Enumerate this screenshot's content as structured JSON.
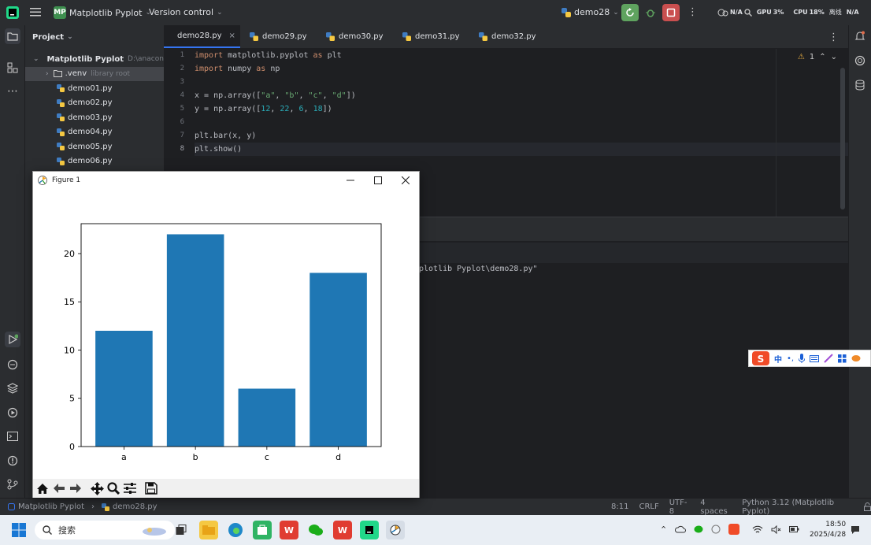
{
  "titlebar": {
    "project_badge": "MP",
    "project_name": "Matplotlib Pyplot",
    "vcs": "Version control",
    "run_config": "demo28",
    "hw_na_1": "N/A",
    "gpu_label": "GPU",
    "gpu_value": "3%",
    "cpu_label": "CPU",
    "cpu_value": "18%",
    "cpu_extra": "离线",
    "hw_na_2": "N/A"
  },
  "project_panel": {
    "header": "Project",
    "root": {
      "name": "Matplotlib Pyplot",
      "path": "D:\\anacond"
    },
    "venv": {
      "name": ".venv",
      "note": "library root"
    },
    "files": [
      "demo01.py",
      "demo02.py",
      "demo03.py",
      "demo04.py",
      "demo05.py",
      "demo06.py"
    ]
  },
  "tabs": [
    "demo28.py",
    "demo29.py",
    "demo30.py",
    "demo31.py",
    "demo32.py"
  ],
  "editor": {
    "warnings": "1",
    "line_numbers": [
      "1",
      "2",
      "3",
      "4",
      "5",
      "6",
      "7",
      "8"
    ],
    "code": {
      "l1": {
        "kw1": "import",
        "mod": " matplotlib.pyplot ",
        "kw2": "as",
        "alias": " plt"
      },
      "l2": {
        "kw1": "import",
        "mod": " numpy ",
        "kw2": "as",
        "alias": " np"
      },
      "l4": {
        "a": "x = np.array([",
        "s1": "\"a\"",
        "c1": ", ",
        "s2": "\"b\"",
        "c2": ", ",
        "s3": "\"c\"",
        "c3": ", ",
        "s4": "\"d\"",
        "b": "])"
      },
      "l5": {
        "a": "y = np.array([",
        "n1": "12",
        "c1": ", ",
        "n2": "22",
        "c2": ", ",
        "n3": "6",
        "c3": ", ",
        "n4": "18",
        "b": "])"
      },
      "l7": "plt.bar(x, y)",
      "l8": "plt.show()"
    }
  },
  "run_output": "plotlib Pyplot\\demo28.py\"",
  "statusbar": {
    "crumb_project": "Matplotlib Pyplot",
    "crumb_file": "demo28.py",
    "position": "8:11",
    "line_sep": "CRLF",
    "encoding": "UTF-8",
    "indent": "4 spaces",
    "interpreter": "Python 3.12 (Matplotlib Pyplot)"
  },
  "figure": {
    "title": "Figure 1"
  },
  "chart_data": {
    "type": "bar",
    "categories": [
      "a",
      "b",
      "c",
      "d"
    ],
    "values": [
      12,
      22,
      6,
      18
    ],
    "ylim": [
      0,
      23.1
    ],
    "yticks": [
      0,
      5,
      10,
      15,
      20
    ],
    "color": "#1f77b4",
    "grid": false
  },
  "ime": {
    "lang": "中",
    "punct": "•,"
  },
  "taskbar": {
    "search_placeholder": "搜索",
    "time": "18:50",
    "date": "2025/4/28"
  },
  "colors": {
    "accent": "#3574f0",
    "bar": "#1f77b4",
    "run_green": "#5fa35f",
    "stop_red": "#c94f4f"
  }
}
